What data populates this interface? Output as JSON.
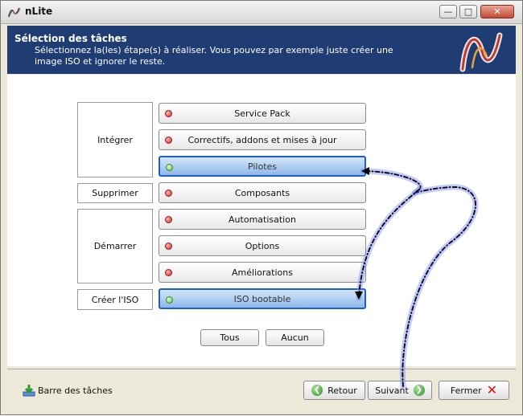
{
  "window": {
    "title": "nLite"
  },
  "header": {
    "title": "Sélection des tâches",
    "description": "Sélectionnez la(les) étape(s) à réaliser. Vous pouvez par exemple juste créer une image ISO et ignorer le reste."
  },
  "groups": {
    "integrer": "Intégrer",
    "supprimer": "Supprimer",
    "demarrer": "Démarrer",
    "creer_iso": "Créer l'ISO"
  },
  "tasks": [
    {
      "label": "Service Pack",
      "selected": false
    },
    {
      "label": "Correctifs, addons et mises à jour",
      "selected": false
    },
    {
      "label": "Pilotes",
      "selected": true
    },
    {
      "label": "Composants",
      "selected": false
    },
    {
      "label": "Automatisation",
      "selected": false
    },
    {
      "label": "Options",
      "selected": false
    },
    {
      "label": "Améliorations",
      "selected": false
    },
    {
      "label": "ISO bootable",
      "selected": true
    }
  ],
  "select_buttons": {
    "all": "Tous",
    "none": "Aucun"
  },
  "footer": {
    "taskbar": "Barre des tâches",
    "back": "Retour",
    "next": "Suivant",
    "close": "Fermer"
  },
  "colors": {
    "header_bg": "#1f3c73",
    "selected_border": "#1b5fcf",
    "indicator_off": "#d22828",
    "indicator_on": "#5fbf4c"
  }
}
